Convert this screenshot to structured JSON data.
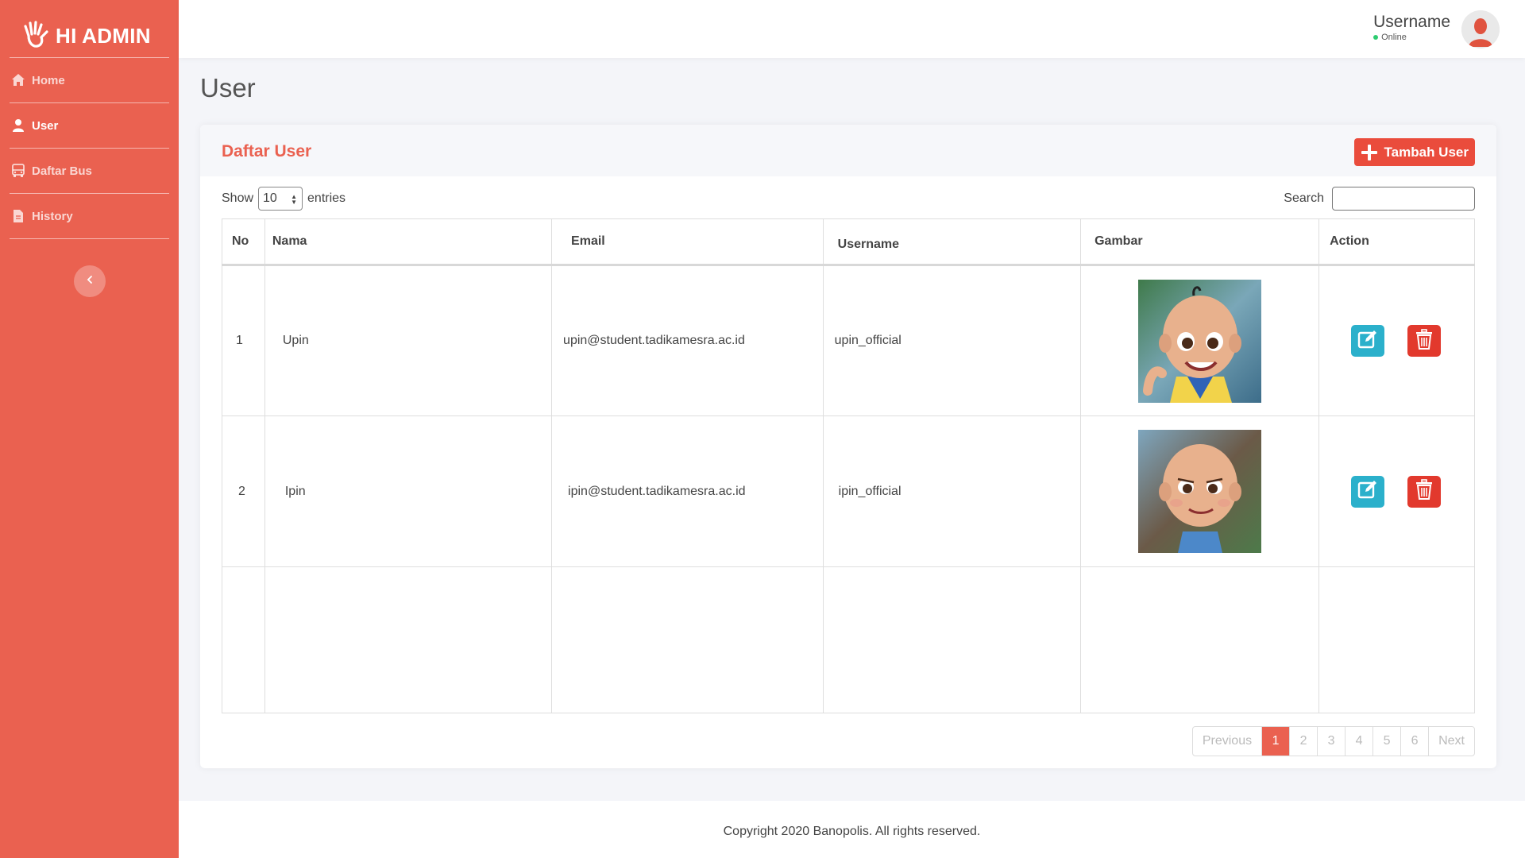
{
  "sidebar": {
    "brand": "HI ADMIN",
    "items": [
      {
        "label": "Home",
        "icon": "home-icon"
      },
      {
        "label": "User",
        "icon": "user-icon"
      },
      {
        "label": "Daftar Bus",
        "icon": "bus-icon"
      },
      {
        "label": "History",
        "icon": "document-icon"
      }
    ],
    "active": "User"
  },
  "topbar": {
    "username": "Username",
    "status": "Online"
  },
  "page": {
    "title": "User",
    "card_title": "Daftar User",
    "add_button": "Tambah User"
  },
  "controls": {
    "show_label": "Show",
    "entries_value": "10",
    "entries_label": "entries",
    "search_label": "Search",
    "search_value": ""
  },
  "table": {
    "headers": [
      "No",
      "Nama",
      "Email",
      "Username",
      "Gambar",
      "Action"
    ],
    "rows": [
      {
        "no": "1",
        "nama": "Upin",
        "email": "upin@student.tadikamesra.ac.id",
        "username": "upin_official"
      },
      {
        "no": "2",
        "nama": "Ipin",
        "email": "ipin@student.tadikamesra.ac.id",
        "username": "ipin_official"
      }
    ]
  },
  "pagination": {
    "previous": "Previous",
    "pages": [
      "1",
      "2",
      "3",
      "4",
      "5",
      "6"
    ],
    "current": "1",
    "next": "Next"
  },
  "footer": {
    "text": "Copyright 2020 Banopolis. All rights reserved."
  },
  "colors": {
    "sidebar": "#ea6150",
    "accent": "#ea4c3c",
    "edit": "#2bb0cb",
    "delete": "#e2392d",
    "online": "#2ecc71"
  }
}
